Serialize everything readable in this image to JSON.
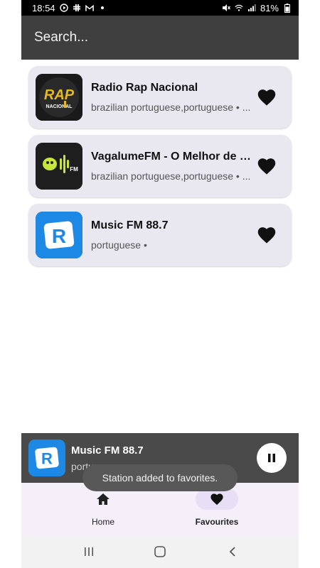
{
  "status_bar": {
    "time": "18:54",
    "notification_icons": [
      "play-circle-icon",
      "slack-icon",
      "gmail-icon",
      "dot-icon"
    ],
    "battery": "81%",
    "system_icons": [
      "mute-icon",
      "wifi-icon",
      "signal-icon",
      "battery-icon"
    ]
  },
  "search": {
    "placeholder": "Search..."
  },
  "stations": [
    {
      "name": "Radio Rap Nacional",
      "languages": "brazilian portuguese,portuguese • ...",
      "logo": "rap-nacional-logo",
      "favorite": true
    },
    {
      "name": "VagalumeFM - O Melhor de Pi...",
      "languages": "brazilian portuguese,portuguese • ...",
      "logo": "vagalume-fm-logo",
      "favorite": true
    },
    {
      "name": "Music FM 88.7",
      "languages": "portuguese •",
      "logo": "music-fm-logo",
      "favorite": true
    }
  ],
  "now_playing": {
    "title": "Music FM 88.7",
    "subtitle": "portuguese •",
    "state": "playing"
  },
  "toast": {
    "message": "Station added to favorites."
  },
  "bottom_nav": {
    "items": [
      {
        "label": "Home",
        "icon": "home-icon",
        "active": false
      },
      {
        "label": "Favourites",
        "icon": "heart-icon",
        "active": true
      }
    ]
  },
  "colors": {
    "header": "#3f3f3f",
    "card": "#e9e8f1",
    "now_playing": "#4a4a4a",
    "nav_active_pill": "#e8def6",
    "logo_blue": "#1e88e5"
  }
}
